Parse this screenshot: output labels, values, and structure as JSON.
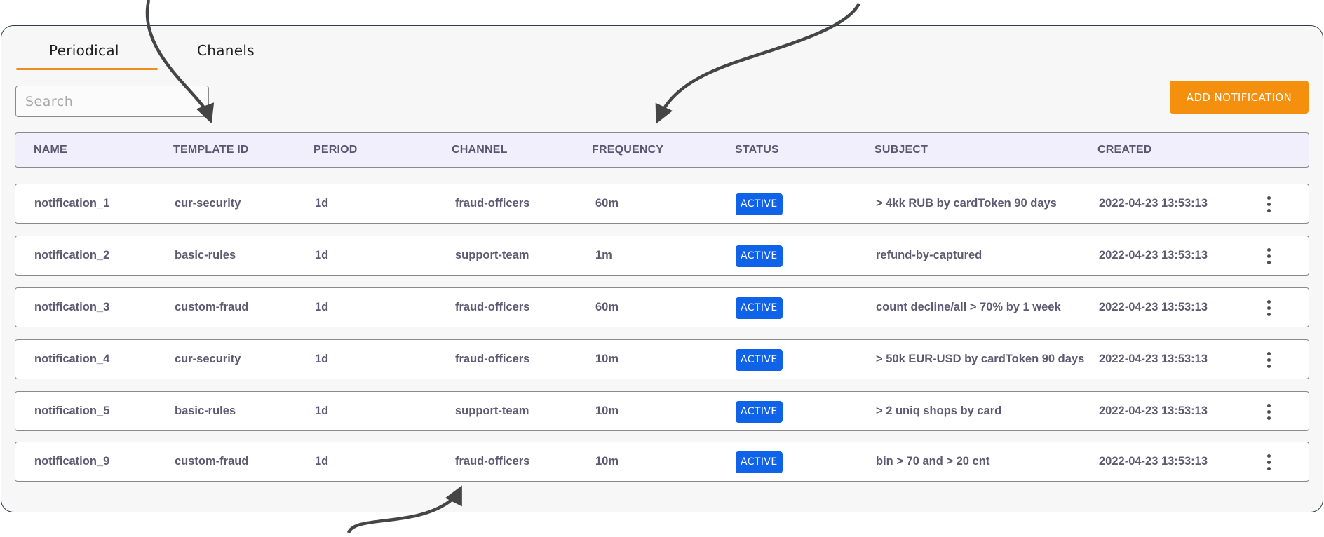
{
  "tabs": [
    {
      "label": "Periodical",
      "active": true
    },
    {
      "label": "Chanels",
      "active": false
    }
  ],
  "search": {
    "placeholder": "Search",
    "value": ""
  },
  "add_button": {
    "label": "ADD NOTIFICATION"
  },
  "columns": [
    "NAME",
    "TEMPLATE ID",
    "PERIOD",
    "CHANNEL",
    "FREQUENCY",
    "STATUS",
    "SUBJECT",
    "CREATED"
  ],
  "rows": [
    {
      "name": "notification_1",
      "template_id": "cur-security",
      "period": "1d",
      "channel": "fraud-officers",
      "frequency": "60m",
      "status": "ACTIVE",
      "subject": "> 4kk RUB by cardToken 90 days",
      "created": "2022-04-23 13:53:13"
    },
    {
      "name": "notification_2",
      "template_id": "basic-rules",
      "period": "1d",
      "channel": "support-team",
      "frequency": "1m",
      "status": "ACTIVE",
      "subject": "refund-by-captured",
      "created": "2022-04-23 13:53:13"
    },
    {
      "name": "notification_3",
      "template_id": "custom-fraud",
      "period": "1d",
      "channel": "fraud-officers",
      "frequency": "60m",
      "status": "ACTIVE",
      "subject": "count decline/all > 70% by 1 week",
      "created": "2022-04-23 13:53:13"
    },
    {
      "name": "notification_4",
      "template_id": "cur-security",
      "period": "1d",
      "channel": "fraud-officers",
      "frequency": "10m",
      "status": "ACTIVE",
      "subject": "> 50k EUR-USD by cardToken 90 days",
      "created": "2022-04-23 13:53:13"
    },
    {
      "name": "notification_5",
      "template_id": "basic-rules",
      "period": "1d",
      "channel": "support-team",
      "frequency": "10m",
      "status": "ACTIVE",
      "subject": "> 2 uniq shops by card",
      "created": "2022-04-23 13:53:13"
    },
    {
      "name": "notification_9",
      "template_id": "custom-fraud",
      "period": "1d",
      "channel": "fraud-officers",
      "frequency": "10m",
      "status": "ACTIVE",
      "subject": "bin > 70 and > 20 cnt",
      "created": "2022-04-23 13:53:13"
    }
  ],
  "icons": {
    "row_menu": "more-vertical-icon",
    "annotation": "arrow-icon"
  },
  "colors": {
    "accent": "#f5900f",
    "status_active": "#0e63e9",
    "header_bg": "#f1effc",
    "panel_border": "#333a47"
  }
}
